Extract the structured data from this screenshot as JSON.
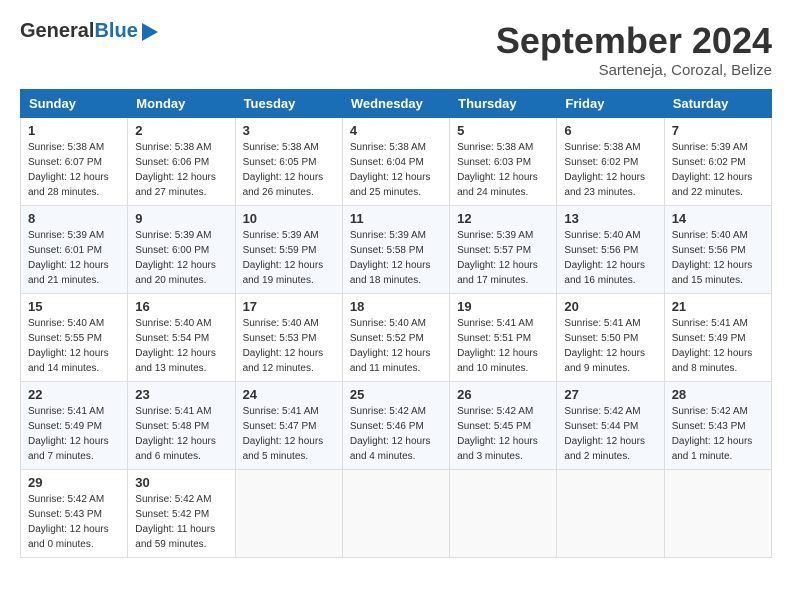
{
  "header": {
    "logo_general": "General",
    "logo_blue": "Blue",
    "month_title": "September 2024",
    "location": "Sarteneja, Corozal, Belize"
  },
  "calendar": {
    "days_of_week": [
      "Sunday",
      "Monday",
      "Tuesday",
      "Wednesday",
      "Thursday",
      "Friday",
      "Saturday"
    ],
    "weeks": [
      [
        {
          "day": "1",
          "sunrise": "5:38 AM",
          "sunset": "6:07 PM",
          "daylight": "12 hours and 28 minutes."
        },
        {
          "day": "2",
          "sunrise": "5:38 AM",
          "sunset": "6:06 PM",
          "daylight": "12 hours and 27 minutes."
        },
        {
          "day": "3",
          "sunrise": "5:38 AM",
          "sunset": "6:05 PM",
          "daylight": "12 hours and 26 minutes."
        },
        {
          "day": "4",
          "sunrise": "5:38 AM",
          "sunset": "6:04 PM",
          "daylight": "12 hours and 25 minutes."
        },
        {
          "day": "5",
          "sunrise": "5:38 AM",
          "sunset": "6:03 PM",
          "daylight": "12 hours and 24 minutes."
        },
        {
          "day": "6",
          "sunrise": "5:38 AM",
          "sunset": "6:02 PM",
          "daylight": "12 hours and 23 minutes."
        },
        {
          "day": "7",
          "sunrise": "5:39 AM",
          "sunset": "6:02 PM",
          "daylight": "12 hours and 22 minutes."
        }
      ],
      [
        {
          "day": "8",
          "sunrise": "5:39 AM",
          "sunset": "6:01 PM",
          "daylight": "12 hours and 21 minutes."
        },
        {
          "day": "9",
          "sunrise": "5:39 AM",
          "sunset": "6:00 PM",
          "daylight": "12 hours and 20 minutes."
        },
        {
          "day": "10",
          "sunrise": "5:39 AM",
          "sunset": "5:59 PM",
          "daylight": "12 hours and 19 minutes."
        },
        {
          "day": "11",
          "sunrise": "5:39 AM",
          "sunset": "5:58 PM",
          "daylight": "12 hours and 18 minutes."
        },
        {
          "day": "12",
          "sunrise": "5:39 AM",
          "sunset": "5:57 PM",
          "daylight": "12 hours and 17 minutes."
        },
        {
          "day": "13",
          "sunrise": "5:40 AM",
          "sunset": "5:56 PM",
          "daylight": "12 hours and 16 minutes."
        },
        {
          "day": "14",
          "sunrise": "5:40 AM",
          "sunset": "5:56 PM",
          "daylight": "12 hours and 15 minutes."
        }
      ],
      [
        {
          "day": "15",
          "sunrise": "5:40 AM",
          "sunset": "5:55 PM",
          "daylight": "12 hours and 14 minutes."
        },
        {
          "day": "16",
          "sunrise": "5:40 AM",
          "sunset": "5:54 PM",
          "daylight": "12 hours and 13 minutes."
        },
        {
          "day": "17",
          "sunrise": "5:40 AM",
          "sunset": "5:53 PM",
          "daylight": "12 hours and 12 minutes."
        },
        {
          "day": "18",
          "sunrise": "5:40 AM",
          "sunset": "5:52 PM",
          "daylight": "12 hours and 11 minutes."
        },
        {
          "day": "19",
          "sunrise": "5:41 AM",
          "sunset": "5:51 PM",
          "daylight": "12 hours and 10 minutes."
        },
        {
          "day": "20",
          "sunrise": "5:41 AM",
          "sunset": "5:50 PM",
          "daylight": "12 hours and 9 minutes."
        },
        {
          "day": "21",
          "sunrise": "5:41 AM",
          "sunset": "5:49 PM",
          "daylight": "12 hours and 8 minutes."
        }
      ],
      [
        {
          "day": "22",
          "sunrise": "5:41 AM",
          "sunset": "5:49 PM",
          "daylight": "12 hours and 7 minutes."
        },
        {
          "day": "23",
          "sunrise": "5:41 AM",
          "sunset": "5:48 PM",
          "daylight": "12 hours and 6 minutes."
        },
        {
          "day": "24",
          "sunrise": "5:41 AM",
          "sunset": "5:47 PM",
          "daylight": "12 hours and 5 minutes."
        },
        {
          "day": "25",
          "sunrise": "5:42 AM",
          "sunset": "5:46 PM",
          "daylight": "12 hours and 4 minutes."
        },
        {
          "day": "26",
          "sunrise": "5:42 AM",
          "sunset": "5:45 PM",
          "daylight": "12 hours and 3 minutes."
        },
        {
          "day": "27",
          "sunrise": "5:42 AM",
          "sunset": "5:44 PM",
          "daylight": "12 hours and 2 minutes."
        },
        {
          "day": "28",
          "sunrise": "5:42 AM",
          "sunset": "5:43 PM",
          "daylight": "12 hours and 1 minute."
        }
      ],
      [
        {
          "day": "29",
          "sunrise": "5:42 AM",
          "sunset": "5:43 PM",
          "daylight": "12 hours and 0 minutes."
        },
        {
          "day": "30",
          "sunrise": "5:42 AM",
          "sunset": "5:42 PM",
          "daylight": "11 hours and 59 minutes."
        },
        null,
        null,
        null,
        null,
        null
      ]
    ],
    "labels": {
      "sunrise": "Sunrise:",
      "sunset": "Sunset:",
      "daylight": "Daylight:"
    }
  }
}
